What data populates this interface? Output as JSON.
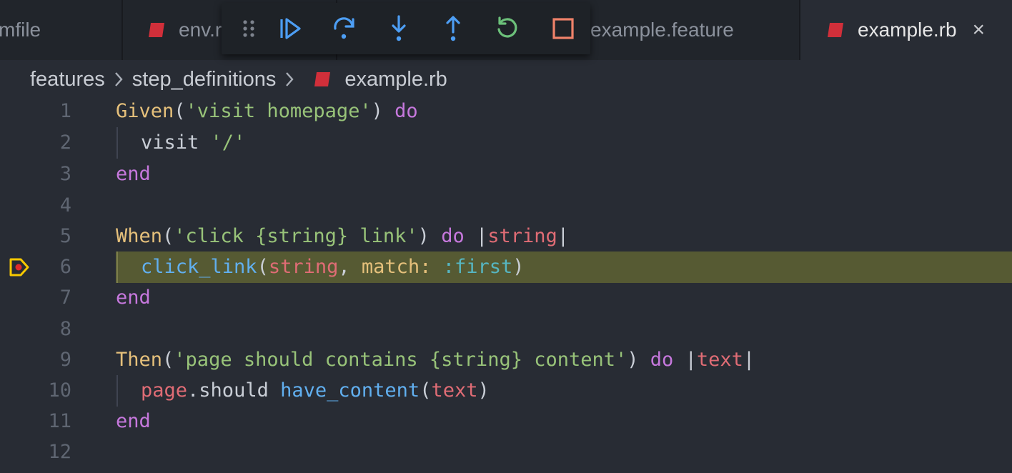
{
  "tabs": [
    {
      "label": "mfile",
      "icon": null,
      "active": false
    },
    {
      "label": "env.r",
      "icon": "ruby-icon",
      "active": false
    },
    {
      "label": "example.feature",
      "icon": null,
      "active": false
    },
    {
      "label": "example.rb",
      "icon": "ruby-icon",
      "active": true,
      "close": "×"
    }
  ],
  "debug_toolbar": {
    "buttons": [
      "drag-handle",
      "continue",
      "step-over",
      "step-into",
      "step-out",
      "restart",
      "stop"
    ],
    "colors": {
      "blue": "#4d9ef4",
      "green": "#6cc07a",
      "red": "#f0826a",
      "handle": "#7d838d"
    }
  },
  "breadcrumb": {
    "items": [
      "features",
      "step_definitions",
      "example.rb"
    ]
  },
  "editor": {
    "current_line": 6,
    "lines": [
      {
        "n": "1"
      },
      {
        "n": "2"
      },
      {
        "n": "3"
      },
      {
        "n": "4"
      },
      {
        "n": "5"
      },
      {
        "n": "6"
      },
      {
        "n": "7"
      },
      {
        "n": "8"
      },
      {
        "n": "9"
      },
      {
        "n": "10"
      },
      {
        "n": "11"
      },
      {
        "n": "12"
      }
    ],
    "tokens": {
      "l1": [
        "Given",
        "(",
        "'visit homepage'",
        ")",
        " ",
        "do"
      ],
      "l2": [
        "visit",
        " ",
        "'/'"
      ],
      "l3": [
        "end"
      ],
      "l5": [
        "When",
        "(",
        "'click {string} link'",
        ")",
        " ",
        "do",
        " ",
        "|",
        "string",
        "|"
      ],
      "l6": [
        "click_link",
        "(",
        "string",
        ", ",
        "match:",
        " ",
        ":first",
        ")"
      ],
      "l7": [
        "end"
      ],
      "l9": [
        "Then",
        "(",
        "'page should contains {string} content'",
        ")",
        " ",
        "do",
        " ",
        "|",
        "text",
        "|"
      ],
      "l10": [
        "page",
        ".",
        "should",
        " ",
        "have_content",
        "(",
        "text",
        ")"
      ],
      "l11": [
        "end"
      ]
    }
  },
  "colors": {
    "background": "#282c34",
    "tabbar": "#21252b",
    "current_line": "#565a33",
    "breakpoint_arrow": "#f7c900",
    "breakpoint_dot": "#e02b2b",
    "ruby_red": "#d12f3a"
  }
}
